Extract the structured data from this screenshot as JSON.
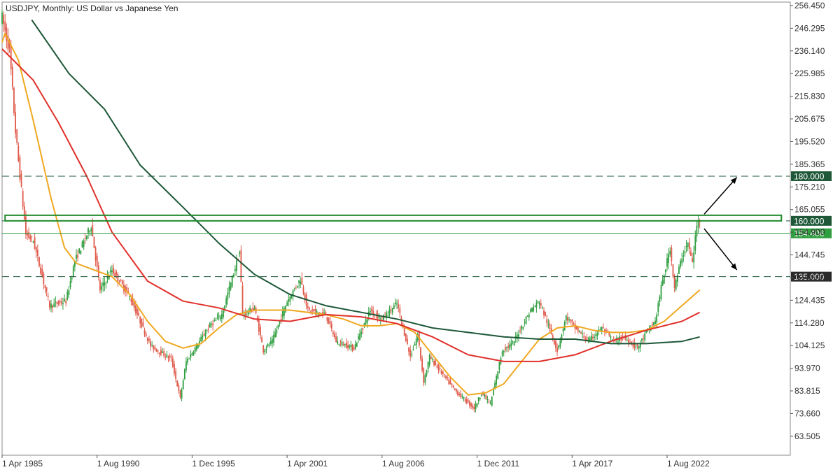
{
  "header": {
    "title": "USDJPY, Monthly:  US Dollar vs Japanese Yen"
  },
  "chart_data": {
    "type": "candlestick",
    "title": "USDJPY, Monthly:  US Dollar vs Japanese Yen",
    "symbol": "USDJPY",
    "timeframe": "Monthly",
    "y_axis": {
      "position": "right",
      "range": [
        55.0,
        258.0
      ],
      "tick_labels": [
        "256.450",
        "246.295",
        "236.140",
        "225.985",
        "215.830",
        "205.675",
        "195.520",
        "185.365",
        "175.210",
        "165.055",
        "154.900",
        "144.745",
        "134.590",
        "124.435",
        "114.280",
        "104.125",
        "93.970",
        "83.815",
        "73.660",
        "63.505"
      ]
    },
    "x_axis": {
      "range": [
        "1985-04",
        "2029-07"
      ],
      "tick_labels": [
        {
          "label": "1 Apr 1985",
          "date": "1985-04"
        },
        {
          "label": "1 Aug 1990",
          "date": "1990-08"
        },
        {
          "label": "1 Dec 1995",
          "date": "1995-12"
        },
        {
          "label": "1 Apr 2001",
          "date": "2001-04"
        },
        {
          "label": "1 Aug 2006",
          "date": "2006-08"
        },
        {
          "label": "1 Dec 2011",
          "date": "2011-12"
        },
        {
          "label": "1 Apr 2017",
          "date": "2017-04"
        },
        {
          "label": "1 Aug 2022",
          "date": "2022-08"
        }
      ]
    },
    "grid": false,
    "bull_color": "#2e9e3e",
    "bear_color": "#e05a4a",
    "price_keypoints": [
      [
        "1985-04",
        251.0
      ],
      [
        "1985-09",
        236.0
      ],
      [
        "1986-01",
        200.0
      ],
      [
        "1986-08",
        154.0
      ],
      [
        "1987-01",
        151.0
      ],
      [
        "1987-12",
        122.0
      ],
      [
        "1988-11",
        124.0
      ],
      [
        "1989-05",
        142.0
      ],
      [
        "1990-04",
        158.0
      ],
      [
        "1990-10",
        129.0
      ],
      [
        "1991-06",
        138.0
      ],
      [
        "1992-06",
        126.0
      ],
      [
        "1993-08",
        104.0
      ],
      [
        "1994-10",
        98.0
      ],
      [
        "1995-04",
        80.5
      ],
      [
        "1995-08",
        97.0
      ],
      [
        "1996-12",
        113.0
      ],
      [
        "1997-08",
        118.0
      ],
      [
        "1998-08",
        146.0
      ],
      [
        "1998-10",
        118.0
      ],
      [
        "1999-06",
        121.0
      ],
      [
        "1999-12",
        102.0
      ],
      [
        "2000-06",
        106.0
      ],
      [
        "2001-04",
        124.0
      ],
      [
        "2002-01",
        134.0
      ],
      [
        "2002-06",
        120.0
      ],
      [
        "2003-06",
        118.0
      ],
      [
        "2004-01",
        106.0
      ],
      [
        "2005-01",
        103.0
      ],
      [
        "2005-12",
        120.0
      ],
      [
        "2006-08",
        116.0
      ],
      [
        "2007-06",
        123.0
      ],
      [
        "2008-03",
        99.0
      ],
      [
        "2008-08",
        109.0
      ],
      [
        "2008-12",
        88.0
      ],
      [
        "2009-04",
        99.0
      ],
      [
        "2010-09",
        84.0
      ],
      [
        "2011-10",
        76.0
      ],
      [
        "2012-03",
        83.0
      ],
      [
        "2012-09",
        78.0
      ],
      [
        "2013-05",
        102.0
      ],
      [
        "2013-12",
        105.0
      ],
      [
        "2014-12",
        120.0
      ],
      [
        "2015-06",
        124.0
      ],
      [
        "2016-06",
        102.0
      ],
      [
        "2016-12",
        117.0
      ],
      [
        "2017-06",
        112.0
      ],
      [
        "2018-03",
        106.0
      ],
      [
        "2018-12",
        112.0
      ],
      [
        "2019-08",
        106.0
      ],
      [
        "2020-03",
        108.0
      ],
      [
        "2020-12",
        103.0
      ],
      [
        "2021-06",
        110.0
      ],
      [
        "2021-12",
        115.0
      ],
      [
        "2022-04",
        130.0
      ],
      [
        "2022-10",
        148.0
      ],
      [
        "2023-01",
        130.0
      ],
      [
        "2023-06",
        144.0
      ],
      [
        "2023-10",
        150.0
      ],
      [
        "2024-01",
        141.0
      ],
      [
        "2024-04",
        158.0
      ],
      [
        "2024-06",
        161.0
      ]
    ],
    "series": [
      {
        "name": "",
        "color": "#f0a820",
        "values": [
          [
            "1985-04",
            240.0
          ],
          [
            "1985-06",
            244.0
          ],
          [
            "1986-03",
            232.0
          ],
          [
            "1987-01",
            205.0
          ],
          [
            "1988-01",
            170.0
          ],
          [
            "1988-10",
            148.0
          ],
          [
            "1989-06",
            141.0
          ],
          [
            "1990-06",
            138.0
          ],
          [
            "1991-06",
            135.0
          ],
          [
            "1992-06",
            127.0
          ],
          [
            "1993-06",
            115.0
          ],
          [
            "1994-06",
            106.0
          ],
          [
            "1995-06",
            103.0
          ],
          [
            "1996-06",
            105.0
          ],
          [
            "1997-06",
            112.0
          ],
          [
            "1998-06",
            118.0
          ],
          [
            "1999-06",
            120.0
          ],
          [
            "2000-06",
            120.0
          ],
          [
            "2001-06",
            120.0
          ],
          [
            "2002-06",
            119.0
          ],
          [
            "2003-06",
            118.0
          ],
          [
            "2004-06",
            116.0
          ],
          [
            "2005-06",
            113.0
          ],
          [
            "2006-06",
            113.0
          ],
          [
            "2007-06",
            114.0
          ],
          [
            "2008-06",
            110.0
          ],
          [
            "2009-06",
            100.0
          ],
          [
            "2010-06",
            90.0
          ],
          [
            "2011-06",
            82.0
          ],
          [
            "2012-06",
            83.0
          ],
          [
            "2013-06",
            87.0
          ],
          [
            "2014-06",
            97.0
          ],
          [
            "2015-06",
            107.0
          ],
          [
            "2016-06",
            112.0
          ],
          [
            "2017-06",
            113.0
          ],
          [
            "2018-06",
            111.0
          ],
          [
            "2019-06",
            110.0
          ],
          [
            "2020-06",
            110.0
          ],
          [
            "2021-06",
            111.0
          ],
          [
            "2022-06",
            115.0
          ],
          [
            "2023-06",
            122.0
          ],
          [
            "2024-06",
            129.0
          ]
        ]
      },
      {
        "name": "",
        "color": "#e0302a",
        "values": [
          [
            "1985-04",
            237.0
          ],
          [
            "1987-01",
            223.0
          ],
          [
            "1988-06",
            204.0
          ],
          [
            "1990-01",
            180.0
          ],
          [
            "1991-06",
            155.0
          ],
          [
            "1993-06",
            133.0
          ],
          [
            "1995-06",
            124.0
          ],
          [
            "1997-06",
            121.0
          ],
          [
            "1999-06",
            116.0
          ],
          [
            "2001-06",
            115.0
          ],
          [
            "2003-06",
            118.0
          ],
          [
            "2005-06",
            117.0
          ],
          [
            "2007-06",
            114.0
          ],
          [
            "2009-06",
            108.0
          ],
          [
            "2011-06",
            100.0
          ],
          [
            "2013-06",
            97.0
          ],
          [
            "2015-06",
            97.0
          ],
          [
            "2017-06",
            100.0
          ],
          [
            "2019-06",
            106.0
          ],
          [
            "2021-06",
            111.0
          ],
          [
            "2023-06",
            115.0
          ],
          [
            "2024-06",
            119.0
          ]
        ]
      },
      {
        "name": "",
        "color": "#1e5838",
        "values": [
          [
            "1986-12",
            250.0
          ],
          [
            "1989-01",
            226.0
          ],
          [
            "1991-01",
            210.0
          ],
          [
            "1993-01",
            185.0
          ],
          [
            "1995-06",
            166.0
          ],
          [
            "1997-06",
            150.0
          ],
          [
            "1999-06",
            136.0
          ],
          [
            "2001-06",
            127.0
          ],
          [
            "2003-06",
            122.0
          ],
          [
            "2005-06",
            119.0
          ],
          [
            "2007-06",
            116.0
          ],
          [
            "2009-06",
            112.0
          ],
          [
            "2011-06",
            110.0
          ],
          [
            "2013-06",
            108.0
          ],
          [
            "2015-06",
            107.0
          ],
          [
            "2017-06",
            107.0
          ],
          [
            "2019-06",
            105.0
          ],
          [
            "2021-06",
            105.0
          ],
          [
            "2023-06",
            106.0
          ],
          [
            "2024-06",
            108.0
          ]
        ]
      }
    ],
    "horizontal_levels": [
      {
        "value": 180.0,
        "label": "180.000",
        "style": "dashed",
        "color": "#1e5838"
      },
      {
        "value": 160.0,
        "label": "160.000",
        "style": "dashed",
        "color": "#1e5838"
      },
      {
        "value": 154.406,
        "label": "154.406",
        "style": "solid",
        "color": "#2e9e3e"
      },
      {
        "value": 135.0,
        "label": "135.000",
        "style": "dashed",
        "color": "#1e5838"
      }
    ],
    "annotations": {
      "resistance_zone": {
        "x_start": "1985-06",
        "x_end": "2029-01",
        "y_low": 160.0,
        "y_high": 162.5,
        "color": "#1e8a2a"
      },
      "arrows": [
        {
          "from": [
            "2024-09",
            163.0
          ],
          "to": [
            "2026-07",
            179.5
          ],
          "direction": "up"
        },
        {
          "from": [
            "2024-09",
            156.5
          ],
          "to": [
            "2026-07",
            138.0
          ],
          "direction": "down"
        }
      ]
    }
  }
}
